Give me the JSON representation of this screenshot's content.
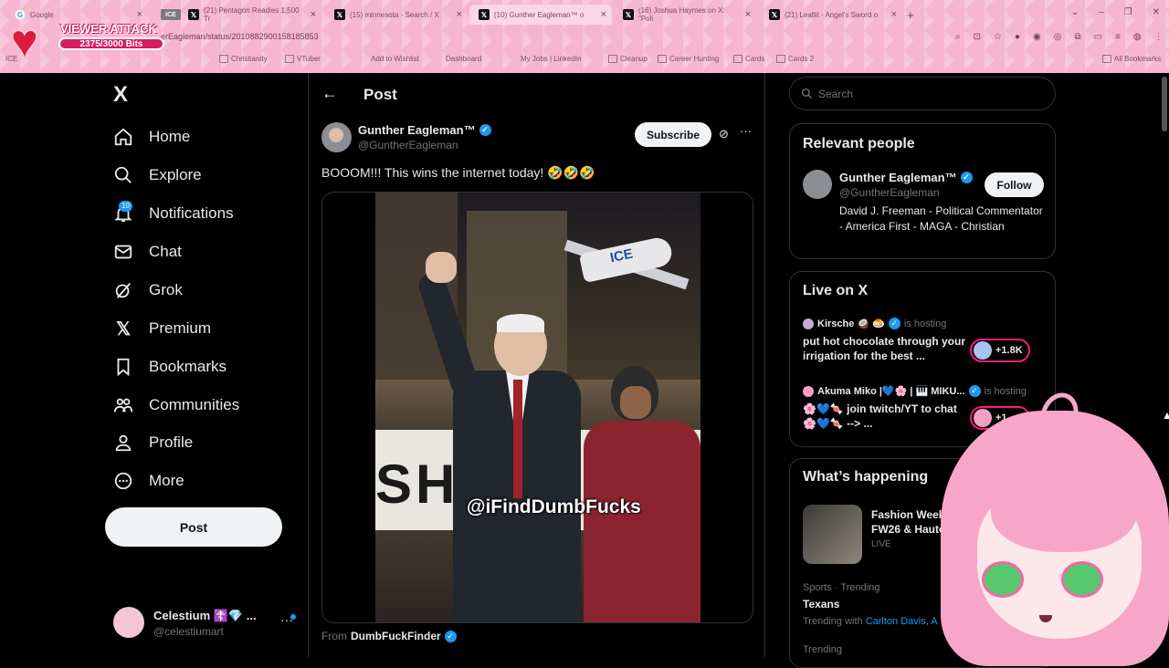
{
  "browser": {
    "tabs": [
      {
        "title": "Google",
        "icon": "google-icon",
        "active": false
      },
      {
        "title": "ICE",
        "icon": "ice-icon",
        "active": false
      },
      {
        "title": "(21) Pentagon Readies 1,500 Tr",
        "icon": "x-icon",
        "active": false
      },
      {
        "title": "(15) minnesota - Search / X",
        "icon": "x-icon",
        "active": false
      },
      {
        "title": "(10) Gunther Eagleman™ o",
        "icon": "x-icon",
        "active": true
      },
      {
        "title": "(16) Joshua Haymes on X: \"Poli",
        "icon": "x-icon",
        "active": false
      },
      {
        "title": "(21) Leaflit · Angel's Sword o",
        "icon": "x-icon",
        "active": false
      }
    ],
    "url": "erEagleman/status/2010882900158185853",
    "bookmarks": [
      "ICE",
      "Christianity",
      "VTuber",
      "Add to Wishlist",
      "Dashboard",
      "My Jobs | LinkedIn",
      "Cleanup",
      "Career Hunting",
      "Cards",
      "Cards 2",
      "All Bookmarks"
    ]
  },
  "overlay": {
    "title": "VIEWER ATTACK",
    "bits": "2375/3000 Bits",
    "bits_progress": 0.7917
  },
  "nav": {
    "logo": "X",
    "items": [
      {
        "label": "Home",
        "icon": "home-icon"
      },
      {
        "label": "Explore",
        "icon": "search-icon"
      },
      {
        "label": "Notifications",
        "icon": "bell-icon"
      },
      {
        "label": "Chat",
        "icon": "mail-icon"
      },
      {
        "label": "Grok",
        "icon": "grok-icon"
      },
      {
        "label": "Premium",
        "icon": "x-premium-icon"
      },
      {
        "label": "Bookmarks",
        "icon": "bookmark-icon"
      },
      {
        "label": "Communities",
        "icon": "communities-icon"
      },
      {
        "label": "Profile",
        "icon": "person-icon"
      },
      {
        "label": "More",
        "icon": "more-circle-icon"
      }
    ],
    "notifications_count": "10",
    "post_button": "Post",
    "account": {
      "name": "Celestium ☦️💎 ...",
      "handle": "@celestiumart"
    }
  },
  "post": {
    "header": "Post",
    "author_name": "Gunther Eagleman™",
    "author_handle": "@GuntherEagleman",
    "subscribe": "Subscribe",
    "text": "BOOOM!!!  This wins the internet today! 🤣🤣🤣",
    "media_watermark": "@iFindDumbFucks",
    "media_banner_text": "SH",
    "media_plane_label": "ICE",
    "from_label": "From",
    "from_account": "DumbFuckFinder"
  },
  "sidebar": {
    "search_placeholder": "Search",
    "relevant": {
      "title": "Relevant people",
      "name": "Gunther Eagleman™",
      "handle": "@GuntherEagleman",
      "follow": "Follow",
      "bio": "David J. Freeman - Political Commentator - America First - MAGA - Christian"
    },
    "live": {
      "title": "Live on X",
      "items": [
        {
          "host": "Kirsche 🥥 🍮",
          "status": "is hosting",
          "title": "put hot chocolate through your irrigation for the best ...",
          "count": "+1.8K"
        },
        {
          "host": "Akuma Miko |💙🌸 | 🎹 MIKU...",
          "status": "is hosting",
          "title": "🌸💙🍬 join twitch/YT to chat 🌸💙🍬 --> ...",
          "count": "+1"
        }
      ]
    },
    "happening": {
      "title": "What’s happening",
      "feature_title": "Fashion Week FW26 & Haute",
      "feature_sub": "LIVE",
      "trend_cat": "Sports · Trending",
      "trend_name": "Texans",
      "trend_with_label": "Trending with",
      "trend_with": "Carlton Davis, A",
      "trend_cat2": "Trending"
    }
  },
  "colors": {
    "accent": "#1d9bf0",
    "background": "#000000",
    "chrome": "#f6b6cf",
    "live_ring": "#f91880"
  }
}
